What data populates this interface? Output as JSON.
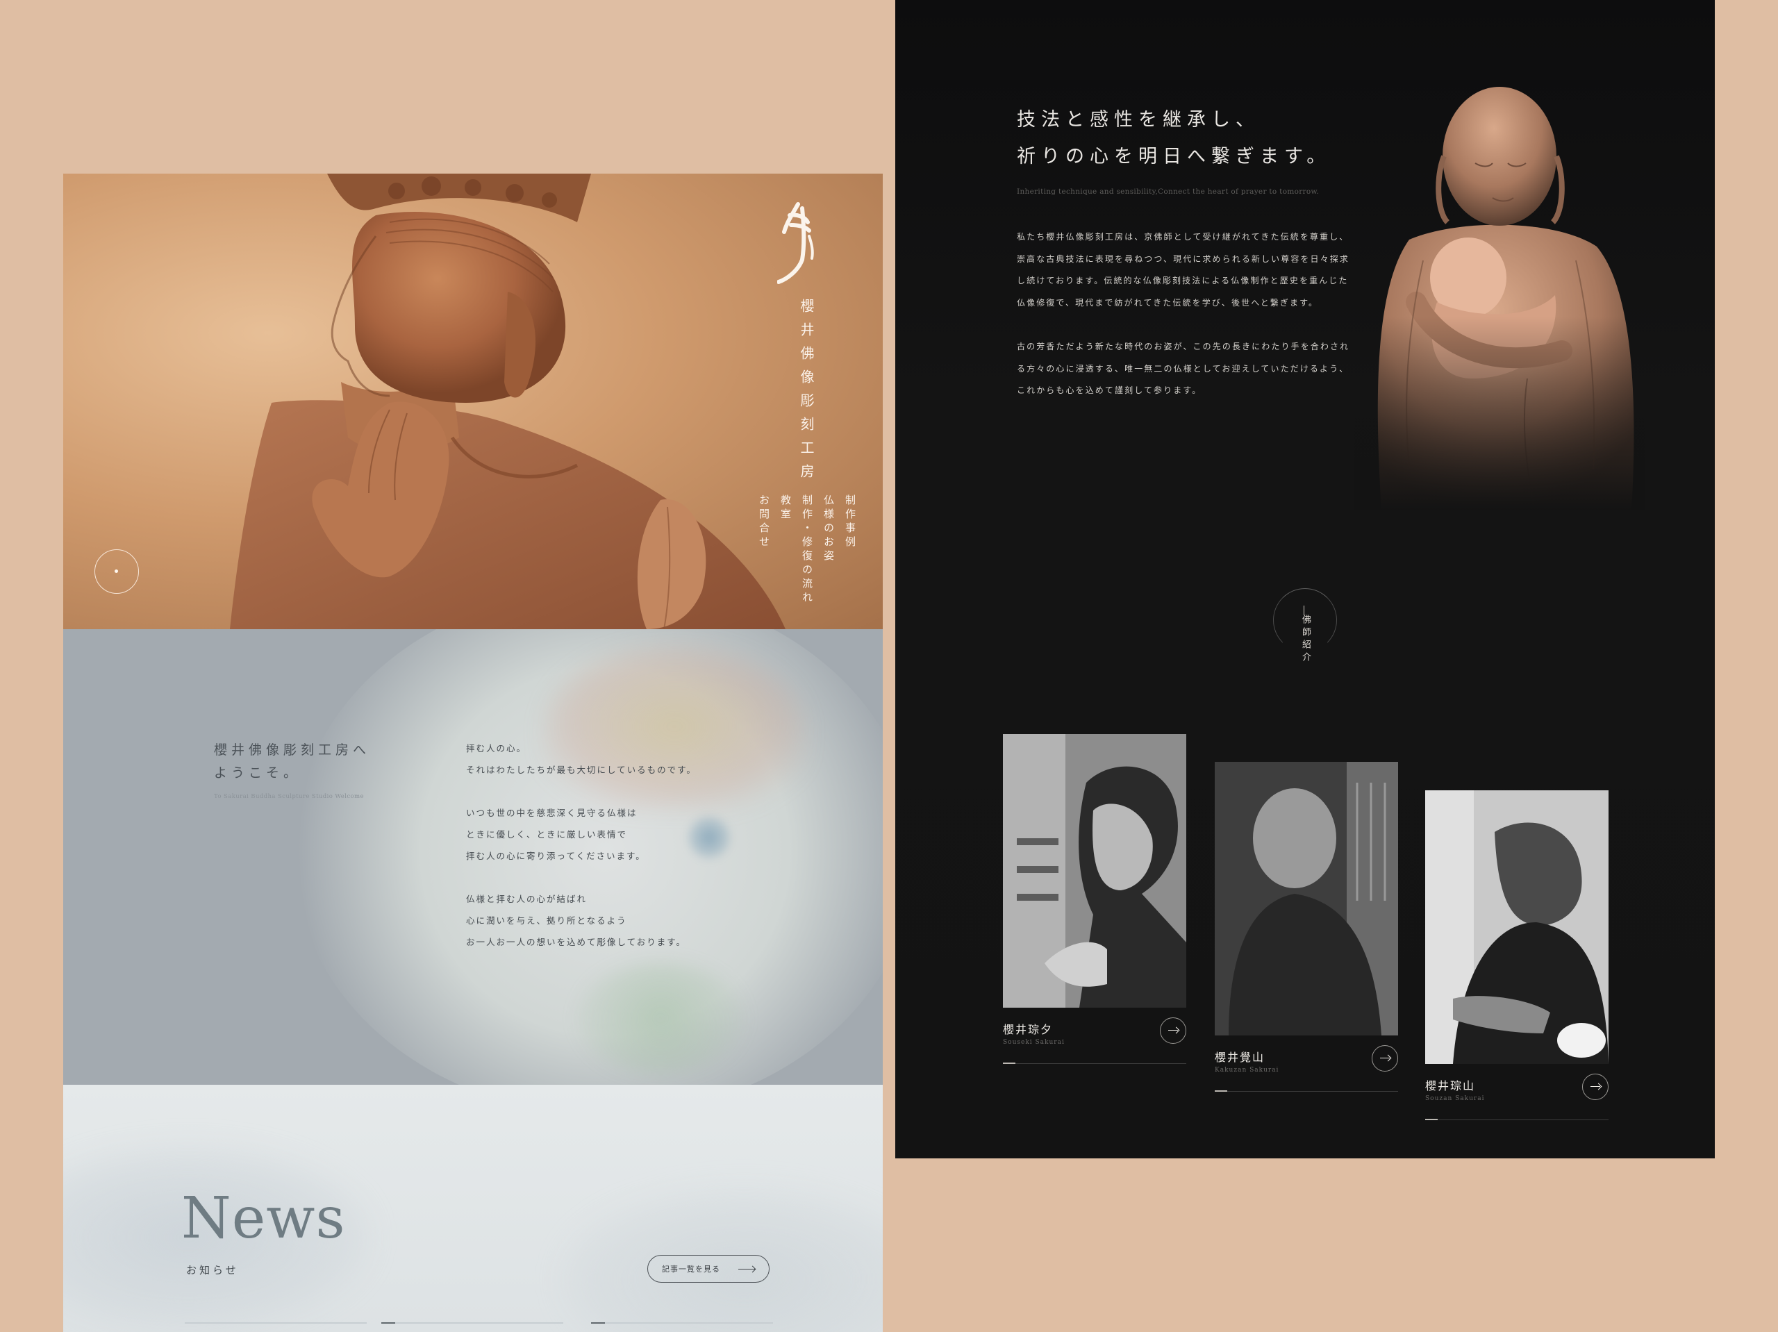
{
  "hero": {
    "logo_glyph": "佛",
    "title": "櫻井佛像彫刻工房",
    "nav": [
      "制作事例",
      "仏様のお姿",
      "制作・修復の流れ",
      "教室",
      "お問合せ"
    ]
  },
  "welcome": {
    "title": "櫻井佛像彫刻工房へ\nようこそ。",
    "subtitle": "To Sakurai Buddha Sculpture Studio Welcome",
    "paragraphs": [
      "拝む人の心。\nそれはわたしたちが最も大切にしているものです。",
      "いつも世の中を慈悲深く見守る仏様は\nときに優しく、ときに厳しい表情で\n拝む人の心に寄り添ってくださいます。",
      "仏様と拝む人の心が結ばれ\n心に潤いを与え、拠り所となるよう\nお一人お一人の想いを込めて彫像しております。"
    ]
  },
  "news": {
    "title": "News",
    "subtitle": "お知らせ",
    "more_label": "記事一覧を見る"
  },
  "intro": {
    "heading": "技法と感性を継承し、\n祈りの心を明日へ繋ぎます。",
    "subtitle_en": "Inheriting technique and sensibility,Connect the heart of prayer to tomorrow.",
    "paragraphs": [
      "私たち櫻井仏像彫刻工房は、京佛師として受け継がれてきた伝統を尊重し、崇高な古典技法に表現を尋ねつつ、現代に求められる新しい尊容を日々探求し続けております。伝統的な仏像彫刻技法による仏像制作と歴史を重んじた仏像修復で、現代まで紡がれてきた伝統を学び、後世へと繋ぎます。",
      "古の芳香ただよう新たな時代のお姿が、この先の長きにわたり手を合わされる方々の心に浸透する、唯一無二の仏様としてお迎えしていただけるよう、これからも心を込めて謹刻して参ります。"
    ]
  },
  "sculptors": {
    "label": "佛師紹介",
    "items": [
      {
        "name": "櫻井琮夕",
        "roman": "Souseki Sakurai"
      },
      {
        "name": "櫻井覺山",
        "roman": "Kakuzan Sakurai"
      },
      {
        "name": "櫻井琮山",
        "roman": "Souzan Sakurai"
      }
    ]
  },
  "colors": {
    "page_bg": "#dfbea3",
    "dark_panel": "#131313",
    "welcome_bg": "#a3aab0",
    "news_bg": "#e5e9ea"
  }
}
